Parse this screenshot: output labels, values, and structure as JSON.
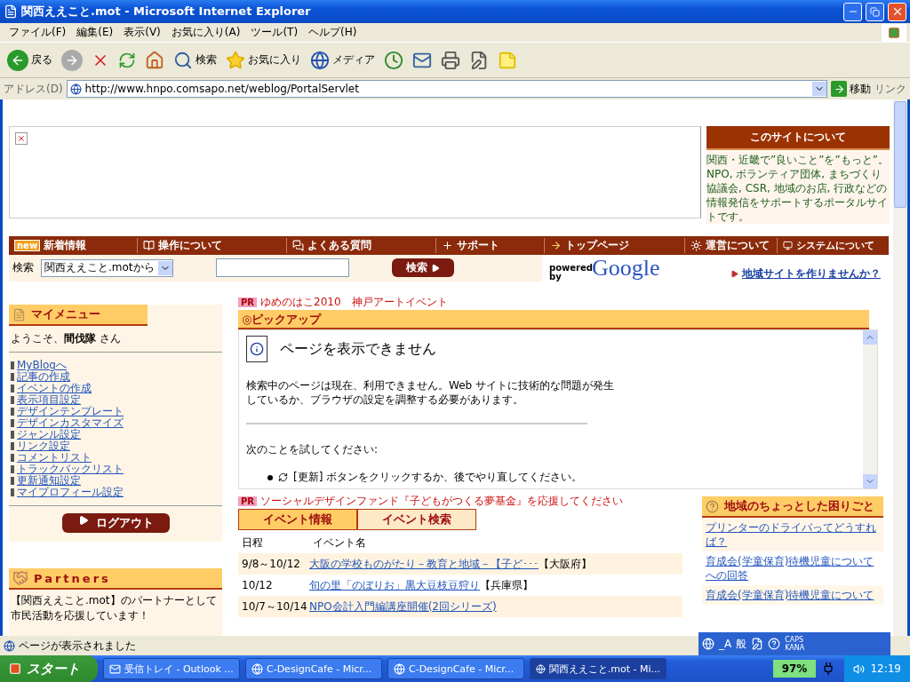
{
  "window": {
    "title": "関西ええこと.mot - Microsoft Internet Explorer"
  },
  "menu": [
    "ファイル(F)",
    "編集(E)",
    "表示(V)",
    "お気に入り(A)",
    "ツール(T)",
    "ヘルプ(H)"
  ],
  "toolbar": [
    {
      "kind": "back",
      "label": "戻る"
    },
    {
      "kind": "forward"
    },
    {
      "kind": "stop"
    },
    {
      "kind": "refresh"
    },
    {
      "kind": "home"
    },
    {
      "kind": "search",
      "label": "検索"
    },
    {
      "kind": "favorites",
      "label": "お気に入り"
    },
    {
      "kind": "media",
      "label": "メディア"
    },
    {
      "kind": "history"
    },
    {
      "kind": "mail"
    },
    {
      "kind": "print"
    },
    {
      "kind": "edit"
    },
    {
      "kind": "note"
    }
  ],
  "address": {
    "label": "アドレス(D)",
    "value": "http://www.hnpo.comsapo.net/weblog/PortalServlet",
    "go": "移動",
    "links": "リンク"
  },
  "about": {
    "title": "このサイトについて",
    "text": "関西・近畿で”良いこと”を”もっと”。NPO, ボランティア団体, まちづくり協議会, CSR, 地域のお店, 行政などの情報発信をサポートするポータルサイトです。"
  },
  "nav": [
    {
      "kind": "new",
      "badge": "new",
      "label": "新着情報"
    },
    {
      "kind": "book",
      "label": "操作について"
    },
    {
      "kind": "qa",
      "label": "よくある質問"
    },
    {
      "kind": "plus",
      "label": "サポート"
    },
    {
      "kind": "arrow",
      "label": "トップページ"
    },
    {
      "kind": "sun",
      "label": "運営について"
    },
    {
      "kind": "system",
      "label": "システムについて"
    }
  ],
  "search": {
    "label": "検索",
    "scope": "関西ええこと.motから",
    "button": "検索",
    "powered": "powered by",
    "logo": "Google"
  },
  "region_link": "地域サイトを作りませんか？",
  "my_menu": {
    "title": "マイメニュー",
    "welcome": "ようこそ、**間伐隊** さん",
    "links": [
      "MyBlogへ",
      "記事の作成",
      "イベントの作成",
      "表示項目設定",
      "デザインテンプレート",
      "デザインカスタマイズ",
      "ジャンル設定",
      "リンク設定",
      "コメントリスト",
      "トラックバックリスト",
      "更新通知設定",
      "マイプロフィール設定"
    ],
    "logout": "ログアウト"
  },
  "partners": {
    "title": "Partners",
    "text": "【関西ええこと.mot】のパートナーとして市民活動を応援しています！"
  },
  "pr_top": {
    "badge": "PR",
    "text": "ゆめのはこ2010　神戸アートイベント"
  },
  "pickup": {
    "title": "◎ピックアップ",
    "error_title": "ページを表示できません",
    "message": "検索中のページは現在、利用できません。Web サイトに技術的な問題が発生しているか、ブラウザの設定を調整する必要があります。",
    "try": "次のことを試してください:",
    "bullet": "[更新] ボタンをクリックするか、後でやり直してください。"
  },
  "pr_bottom": {
    "badge": "PR",
    "text": "ソーシャルデザインファンド『子どもがつくる夢基金』を応援してください"
  },
  "event_tabs": [
    {
      "label": "イベント情報",
      "selected": true
    },
    {
      "label": "イベント検索",
      "selected": false
    }
  ],
  "event_columns": [
    "日程",
    "イベント名"
  ],
  "events": [
    {
      "date": "9/8～10/12",
      "title": "大阪の学校ものがたり－教育と地域－【子ど･･･",
      "pref": "【大阪府】"
    },
    {
      "date": "10/12",
      "title": "旬の里「のぼりお」黒大豆枝豆狩り",
      "pref": "【兵庫県】"
    },
    {
      "date": "10/7～10/14",
      "title": "NPO会計入門編講座開催(2回シリーズ)"
    }
  ],
  "questions": {
    "title": "地域のちょっとした困りごと",
    "items": [
      "プリンターのドライバってどうすれば？",
      "育成会(学童保育)待機児童についてへの回答",
      "育成会(学童保育)待機児童について"
    ]
  },
  "status": "ページが表示されました",
  "langbar": [
    "_A",
    "般",
    "CAPS",
    "KANA"
  ],
  "taskbar": {
    "start": "スタート",
    "tasks": [
      {
        "label": "受信トレイ - Outlook ...",
        "selected": false
      },
      {
        "label": "C-DesignCafe - Micr...",
        "selected": false
      },
      {
        "label": "C-DesignCafe - Micr...",
        "selected": false
      },
      {
        "label": "関西ええこと.mot - Mi...",
        "selected": true
      }
    ],
    "battery": "97%",
    "clock": "12:19"
  }
}
